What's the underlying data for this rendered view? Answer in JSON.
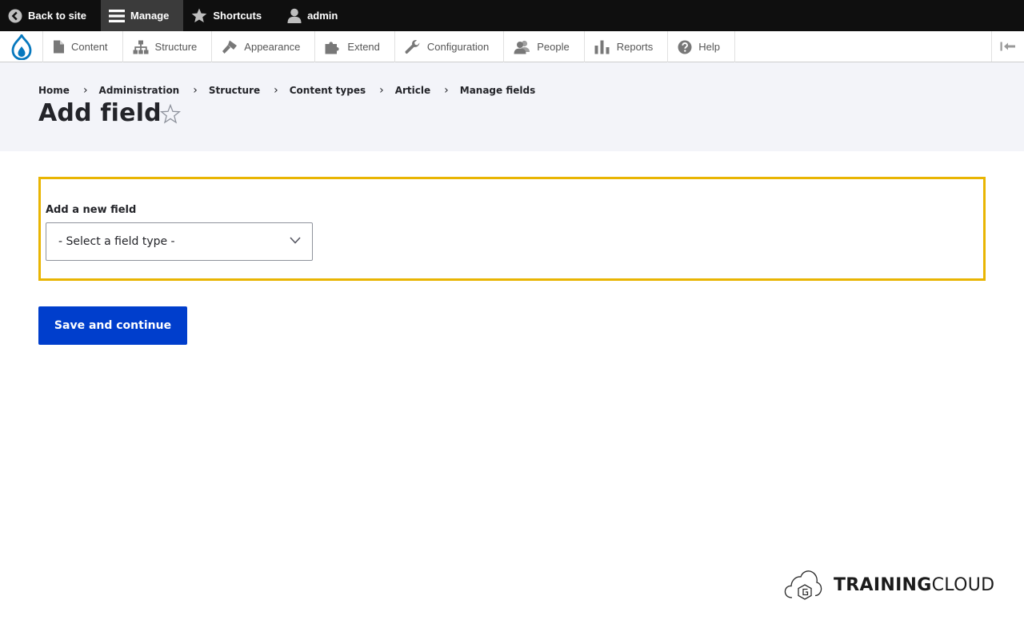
{
  "toolbar": {
    "back_label": "Back to site",
    "manage_label": "Manage",
    "shortcuts_label": "Shortcuts",
    "user_label": "admin"
  },
  "tray": {
    "items": [
      {
        "label": "Content",
        "icon": "document-icon"
      },
      {
        "label": "Structure",
        "icon": "sitemap-icon"
      },
      {
        "label": "Appearance",
        "icon": "paint-icon"
      },
      {
        "label": "Extend",
        "icon": "puzzle-icon"
      },
      {
        "label": "Configuration",
        "icon": "wrench-icon"
      },
      {
        "label": "People",
        "icon": "people-icon"
      },
      {
        "label": "Reports",
        "icon": "chart-icon"
      },
      {
        "label": "Help",
        "icon": "help-icon"
      }
    ]
  },
  "breadcrumb": [
    "Home",
    "Administration",
    "Structure",
    "Content types",
    "Article",
    "Manage fields"
  ],
  "page": {
    "title": "Add field"
  },
  "form": {
    "field_label": "Add a new field",
    "select_value": "- Select a field type -",
    "save_label": "Save and continue"
  },
  "watermark": {
    "bold_part": "TRAINING",
    "light_part": "CLOUD"
  },
  "colors": {
    "accent": "#003ecc",
    "highlight": "#e9b503",
    "toolbar": "#0f0f0f",
    "header_bg": "#f3f4f9"
  }
}
